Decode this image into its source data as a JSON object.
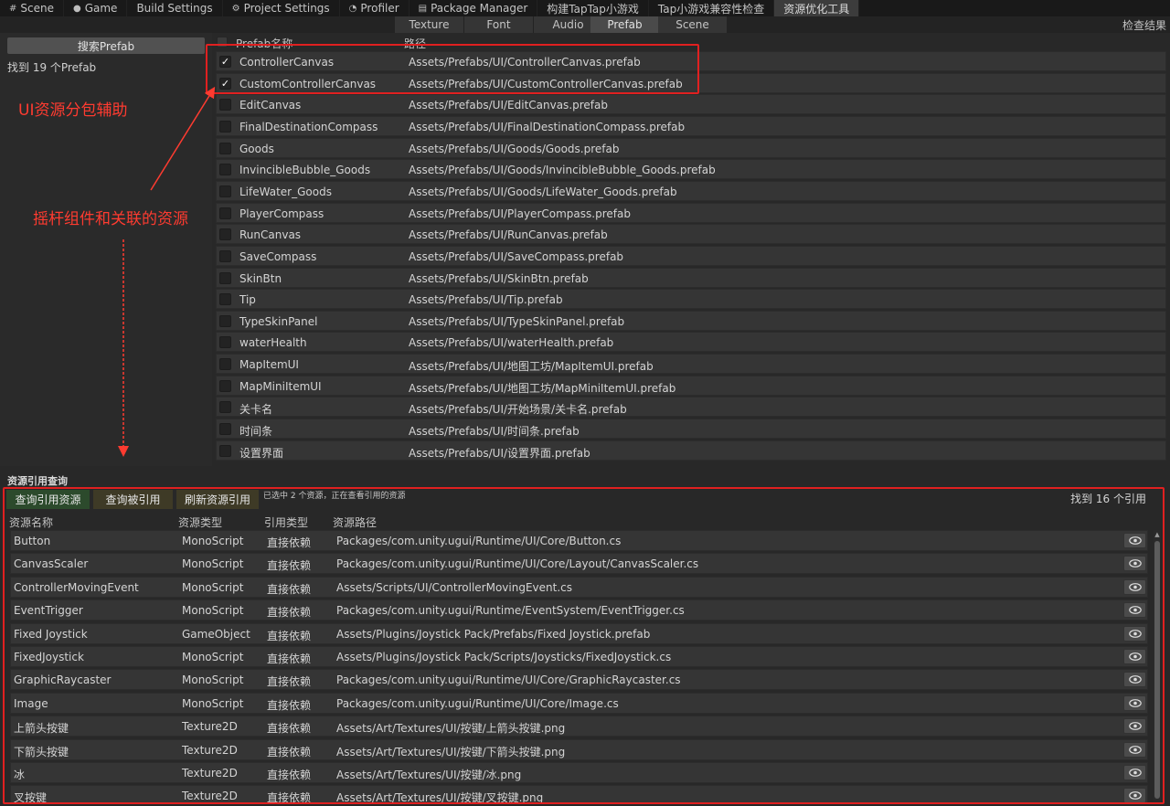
{
  "top_tabs": [
    {
      "label": "Scene",
      "icon": "grid-icon"
    },
    {
      "label": "Game",
      "icon": "gamepad-icon"
    },
    {
      "label": "Build Settings",
      "icon": ""
    },
    {
      "label": "Project Settings",
      "icon": "gear-icon"
    },
    {
      "label": "Profiler",
      "icon": "profiler-icon"
    },
    {
      "label": "Package Manager",
      "icon": "package-icon"
    },
    {
      "label": "构建TapTap小游戏",
      "icon": ""
    },
    {
      "label": "Tap小游戏兼容性检查",
      "icon": ""
    },
    {
      "label": "资源优化工具",
      "icon": ""
    }
  ],
  "category_tabs": [
    "Texture",
    "Font",
    "Audio",
    "Prefab",
    "Scene"
  ],
  "active_category": "Prefab",
  "check_result_label": "检查结果",
  "search": {
    "button_label": "搜索Prefab",
    "found_text": "找到 19 个Prefab"
  },
  "annotations": {
    "ui_bundle": "UI资源分包辅助",
    "joystick": "摇杆组件和关联的资源"
  },
  "prefab_table": {
    "col_name": "Prefab名称",
    "col_path": "路径",
    "rows": [
      {
        "name": "ControllerCanvas",
        "path": "Assets/Prefabs/UI/ControllerCanvas.prefab",
        "checked": true
      },
      {
        "name": "CustomControllerCanvas",
        "path": "Assets/Prefabs/UI/CustomControllerCanvas.prefab",
        "checked": true
      },
      {
        "name": "EditCanvas",
        "path": "Assets/Prefabs/UI/EditCanvas.prefab",
        "checked": false
      },
      {
        "name": "FinalDestinationCompass",
        "path": "Assets/Prefabs/UI/FinalDestinationCompass.prefab",
        "checked": false
      },
      {
        "name": "Goods",
        "path": "Assets/Prefabs/UI/Goods/Goods.prefab",
        "checked": false
      },
      {
        "name": "InvincibleBubble_Goods",
        "path": "Assets/Prefabs/UI/Goods/InvincibleBubble_Goods.prefab",
        "checked": false
      },
      {
        "name": "LifeWater_Goods",
        "path": "Assets/Prefabs/UI/Goods/LifeWater_Goods.prefab",
        "checked": false
      },
      {
        "name": "PlayerCompass",
        "path": "Assets/Prefabs/UI/PlayerCompass.prefab",
        "checked": false
      },
      {
        "name": "RunCanvas",
        "path": "Assets/Prefabs/UI/RunCanvas.prefab",
        "checked": false
      },
      {
        "name": "SaveCompass",
        "path": "Assets/Prefabs/UI/SaveCompass.prefab",
        "checked": false
      },
      {
        "name": "SkinBtn",
        "path": "Assets/Prefabs/UI/SkinBtn.prefab",
        "checked": false
      },
      {
        "name": "Tip",
        "path": "Assets/Prefabs/UI/Tip.prefab",
        "checked": false
      },
      {
        "name": "TypeSkinPanel",
        "path": "Assets/Prefabs/UI/TypeSkinPanel.prefab",
        "checked": false
      },
      {
        "name": "waterHealth",
        "path": "Assets/Prefabs/UI/waterHealth.prefab",
        "checked": false
      },
      {
        "name": "MapItemUI",
        "path": "Assets/Prefabs/UI/地图工坊/MapItemUI.prefab",
        "checked": false
      },
      {
        "name": "MapMiniItemUI",
        "path": "Assets/Prefabs/UI/地图工坊/MapMiniItemUI.prefab",
        "checked": false
      },
      {
        "name": "关卡名",
        "path": "Assets/Prefabs/UI/开始场景/关卡名.prefab",
        "checked": false
      },
      {
        "name": "时间条",
        "path": "Assets/Prefabs/UI/时间条.prefab",
        "checked": false
      },
      {
        "name": "设置界面",
        "path": "Assets/Prefabs/UI/设置界面.prefab",
        "checked": false
      }
    ]
  },
  "ref_section": {
    "title": "资源引用查询",
    "btn_query_refs": "查询引用资源",
    "btn_query_referenced": "查询被引用",
    "btn_refresh": "刷新资源引用",
    "selection_info": "已选中 2 个资源，正在查看引用的资源",
    "found_refs": "找到 16 个引用",
    "columns": {
      "name": "资源名称",
      "type": "资源类型",
      "ref_type": "引用类型",
      "path": "资源路径"
    },
    "rows": [
      {
        "name": "Button",
        "type": "MonoScript",
        "ref": "直接依赖",
        "path": "Packages/com.unity.ugui/Runtime/UI/Core/Button.cs"
      },
      {
        "name": "CanvasScaler",
        "type": "MonoScript",
        "ref": "直接依赖",
        "path": "Packages/com.unity.ugui/Runtime/UI/Core/Layout/CanvasScaler.cs"
      },
      {
        "name": "ControllerMovingEvent",
        "type": "MonoScript",
        "ref": "直接依赖",
        "path": "Assets/Scripts/UI/ControllerMovingEvent.cs"
      },
      {
        "name": "EventTrigger",
        "type": "MonoScript",
        "ref": "直接依赖",
        "path": "Packages/com.unity.ugui/Runtime/EventSystem/EventTrigger.cs"
      },
      {
        "name": "Fixed Joystick",
        "type": "GameObject",
        "ref": "直接依赖",
        "path": "Assets/Plugins/Joystick Pack/Prefabs/Fixed Joystick.prefab"
      },
      {
        "name": "FixedJoystick",
        "type": "MonoScript",
        "ref": "直接依赖",
        "path": "Assets/Plugins/Joystick Pack/Scripts/Joysticks/FixedJoystick.cs"
      },
      {
        "name": "GraphicRaycaster",
        "type": "MonoScript",
        "ref": "直接依赖",
        "path": "Packages/com.unity.ugui/Runtime/UI/Core/GraphicRaycaster.cs"
      },
      {
        "name": "Image",
        "type": "MonoScript",
        "ref": "直接依赖",
        "path": "Packages/com.unity.ugui/Runtime/UI/Core/Image.cs"
      },
      {
        "name": "上箭头按键",
        "type": "Texture2D",
        "ref": "直接依赖",
        "path": "Assets/Art/Textures/UI/按键/上箭头按键.png"
      },
      {
        "name": "下箭头按键",
        "type": "Texture2D",
        "ref": "直接依赖",
        "path": "Assets/Art/Textures/UI/按键/下箭头按键.png"
      },
      {
        "name": "冰",
        "type": "Texture2D",
        "ref": "直接依赖",
        "path": "Assets/Art/Textures/UI/按键/冰.png"
      },
      {
        "name": "叉按键",
        "type": "Texture2D",
        "ref": "直接依赖",
        "path": "Assets/Art/Textures/UI/按键/叉按键.png"
      }
    ]
  },
  "colors": {
    "annotation_red": "#ff3b30",
    "highlight_border": "#e02020"
  }
}
